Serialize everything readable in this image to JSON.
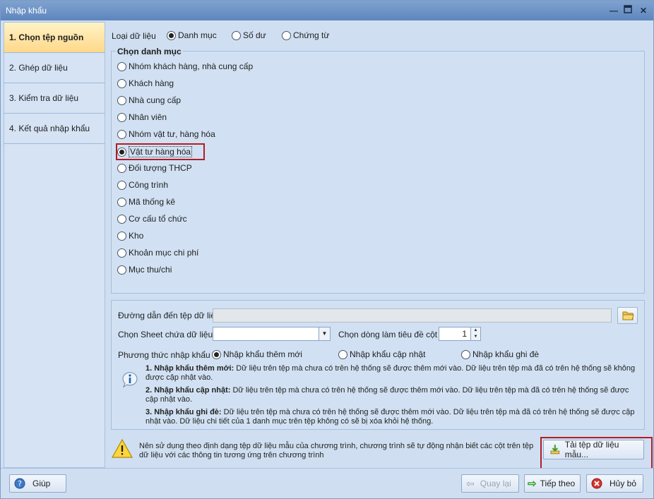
{
  "window": {
    "title": "Nhập khẩu",
    "controls": [
      "minimize-icon",
      "maximize-icon",
      "close-icon"
    ]
  },
  "nav": {
    "items": [
      {
        "label": "1. Chọn tệp nguồn",
        "active": true
      },
      {
        "label": "2. Ghép dữ liệu",
        "active": false
      },
      {
        "label": "3. Kiểm tra dữ liệu",
        "active": false
      },
      {
        "label": "4. Kết quả nhập khẩu",
        "active": false
      }
    ]
  },
  "data_type": {
    "label": "Loại dữ liệu",
    "options": [
      {
        "label": "Danh mục",
        "selected": true
      },
      {
        "label": "Số dư",
        "selected": false
      },
      {
        "label": "Chứng từ",
        "selected": false
      }
    ]
  },
  "catalog": {
    "title": "Chọn danh mục",
    "options": [
      {
        "label": "Nhóm khách hàng, nhà cung cấp",
        "selected": false
      },
      {
        "label": "Khách hàng",
        "selected": false
      },
      {
        "label": "Nhà cung cấp",
        "selected": false
      },
      {
        "label": "Nhân viên",
        "selected": false
      },
      {
        "label": "Nhóm vật tư, hàng hóa",
        "selected": false
      },
      {
        "label": "Vật tư hàng hóa",
        "selected": true
      },
      {
        "label": "Đối tượng THCP",
        "selected": false
      },
      {
        "label": "Công trình",
        "selected": false
      },
      {
        "label": "Mã thống kê",
        "selected": false
      },
      {
        "label": "Cơ cấu tổ chức",
        "selected": false
      },
      {
        "label": "Kho",
        "selected": false
      },
      {
        "label": "Khoản mục chi phí",
        "selected": false
      },
      {
        "label": "Mục thu/chi",
        "selected": false
      }
    ]
  },
  "file": {
    "path_label": "Đường dẫn đến tệp dữ liệu",
    "path_value": "",
    "browse_icon": "folder-icon",
    "sheet_label": "Chọn Sheet chứa dữ liệu",
    "sheet_value": "",
    "header_row_label": "Chọn dòng làm tiêu đề cột",
    "header_row_value": "1"
  },
  "import_method": {
    "label": "Phương thức nhập khẩu",
    "options": [
      {
        "label": "Nhập khẩu thêm mới",
        "selected": true
      },
      {
        "label": "Nhập khẩu cập nhật",
        "selected": false
      },
      {
        "label": "Nhập khẩu ghi đè",
        "selected": false
      }
    ],
    "info_icon": "info-icon",
    "notes": [
      {
        "title": "1. Nhập khẩu thêm mới:",
        "text": "Dữ liệu trên tệp mà chưa có trên hệ thống sẽ được thêm mới vào. Dữ liệu trên tệp mà đã có trên hệ thống sẽ không được cập nhật vào."
      },
      {
        "title": "2. Nhập khẩu cập nhật:",
        "text": "Dữ liệu trên tệp mà chưa có trên hệ thống sẽ được thêm mới vào. Dữ liệu trên tệp mà đã có trên hệ thống sẽ được cập nhật vào."
      },
      {
        "title": "3. Nhập khẩu ghi đè:",
        "text": "Dữ liệu trên tệp mà chưa có trên hệ thống sẽ được thêm mới vào. Dữ liệu trên tệp mà đã có trên hệ thống sẽ được cập nhật vào. Dữ liệu chi tiết của 1 danh mục trên tệp không có sẽ bị xóa khỏi hệ thống."
      }
    ]
  },
  "warning": {
    "icon": "warning-icon",
    "text": "Nên sử dụng theo định dạng tệp dữ liệu mẫu của chương trình, chương trình sẽ tự động nhận biết các cột trên tệp dữ liệu với các thông tin tương ứng trên chương trình",
    "download_label": "Tải tệp dữ liệu mẫu..."
  },
  "footer": {
    "help_label": "Giúp",
    "back_label": "Quay lại",
    "next_label": "Tiếp theo",
    "cancel_label": "Hủy bỏ"
  },
  "colors": {
    "active_nav": "#ffd889",
    "highlight": "#b31c26",
    "window_bg": "#cfdff1"
  }
}
